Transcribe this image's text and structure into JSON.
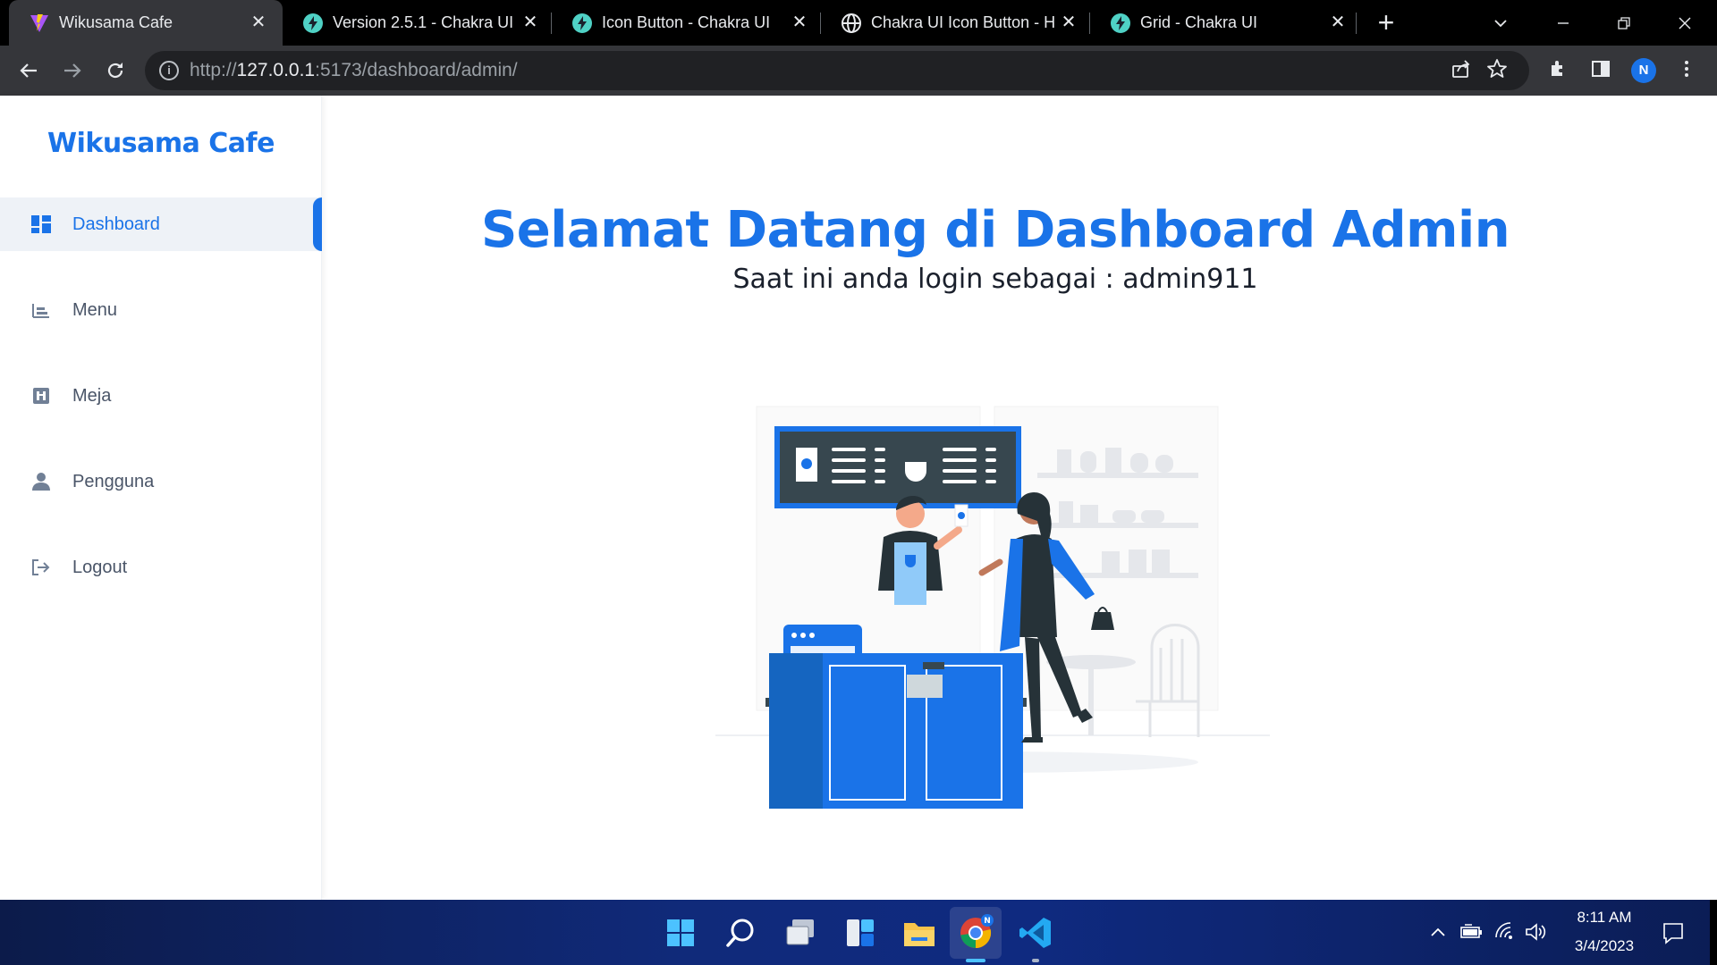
{
  "browser": {
    "tabs": [
      {
        "title": "Wikusama Cafe",
        "active": true,
        "favicon": "vite-icon"
      },
      {
        "title": "Version 2.5.1 - Chakra UI",
        "active": false,
        "favicon": "chakra-icon"
      },
      {
        "title": "Icon Button - Chakra UI",
        "active": false,
        "favicon": "chakra-icon"
      },
      {
        "title": "Chakra UI Icon Button - H",
        "active": false,
        "favicon": "globe-icon"
      },
      {
        "title": "Grid - Chakra UI",
        "active": false,
        "favicon": "chakra-icon"
      }
    ],
    "url_prefix": "http://",
    "url_host": "127.0.0.1",
    "url_rest": ":5173/dashboard/admin/",
    "profile_initial": "N"
  },
  "sidebar": {
    "brand": "Wikusama Cafe",
    "items": [
      {
        "label": "Dashboard",
        "icon": "dashboard-icon",
        "active": true
      },
      {
        "label": "Menu",
        "icon": "menu-icon",
        "active": false
      },
      {
        "label": "Meja",
        "icon": "table-icon",
        "active": false
      },
      {
        "label": "Pengguna",
        "icon": "user-icon",
        "active": false
      },
      {
        "label": "Logout",
        "icon": "logout-icon",
        "active": false
      }
    ]
  },
  "main": {
    "title": "Selamat Datang di Dashboard Admin",
    "subtitle": "Saat ini anda login sebagai : admin911"
  },
  "taskbar": {
    "apps": [
      "windows-start-icon",
      "search-icon",
      "task-view-icon",
      "widgets-icon",
      "file-explorer-icon",
      "chrome-icon",
      "vscode-icon"
    ],
    "time": "8:11 AM",
    "date": "3/4/2023"
  },
  "colors": {
    "accent": "#1a73e8",
    "chrome_dark": "#35363a",
    "tabstrip": "#000000"
  }
}
